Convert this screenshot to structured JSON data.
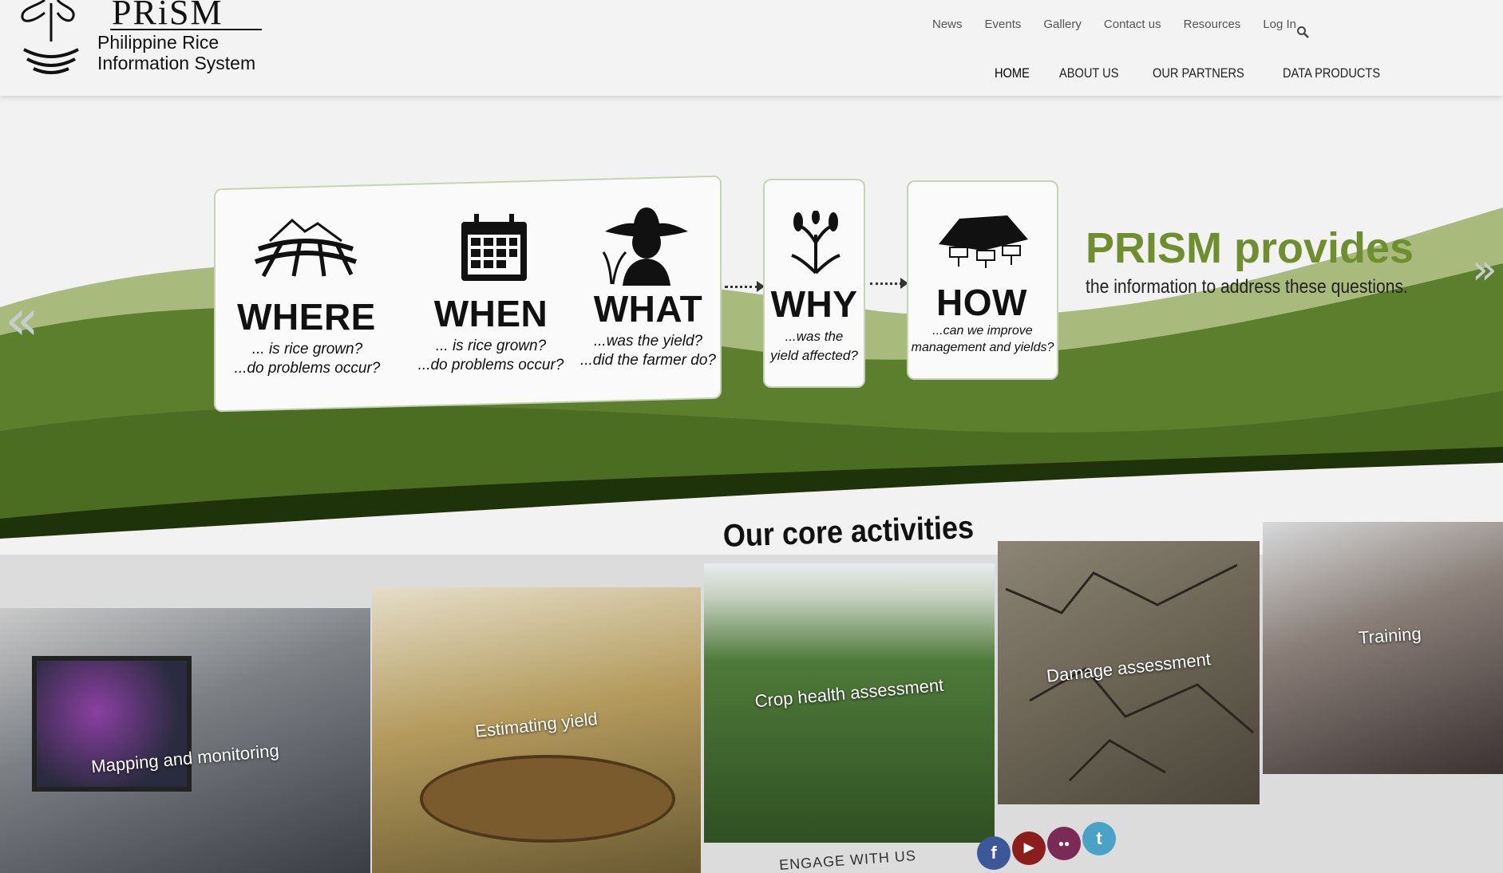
{
  "brand": {
    "wordmark": "PRiSM",
    "subtitle_line1": "Philippine Rice",
    "subtitle_line2": "Information System"
  },
  "utility_nav": [
    "News",
    "Events",
    "Gallery",
    "Contact us",
    "Resources",
    "Log In"
  ],
  "main_nav": [
    "HOME",
    "ABOUT US",
    "OUR PARTNERS",
    "DATA PRODUCTS"
  ],
  "hero": {
    "questions": [
      {
        "word": "WHERE",
        "line1": "... is rice grown?",
        "line2": "...do problems occur?"
      },
      {
        "word": "WHEN",
        "line1": "... is rice grown?",
        "line2": "...do problems occur?"
      },
      {
        "word": "WHAT",
        "line1": "...was the yield?",
        "line2": "...did the farmer do?"
      },
      {
        "word": "WHY",
        "line1": "...was the",
        "line2": "yield affected?"
      },
      {
        "word": "HOW",
        "line1": "...can we improve",
        "line2": "management and yields?"
      }
    ],
    "provides_title": "PRISM provides",
    "provides_sub": "the information to address these questions.",
    "prev_glyph": "«",
    "next_glyph": "»"
  },
  "core": {
    "title": "Our core activities",
    "tiles": [
      "Mapping and monitoring",
      "Estimating yield",
      "Crop health assessment",
      "Damage assessment",
      "Training"
    ]
  },
  "engage": {
    "label": "ENGAGE WITH US",
    "social": [
      {
        "name": "facebook",
        "glyph": "f",
        "color": "#3b5998"
      },
      {
        "name": "youtube",
        "glyph": "▶",
        "color": "#8c1d1d"
      },
      {
        "name": "flickr",
        "glyph": "●●",
        "color": "#7a2a55"
      },
      {
        "name": "twitter",
        "glyph": "t",
        "color": "#4aa3c6"
      }
    ]
  },
  "colors": {
    "accent_green": "#6f8f2e",
    "dark_green": "#2f4a14",
    "mid_green": "#5c7f2e"
  }
}
